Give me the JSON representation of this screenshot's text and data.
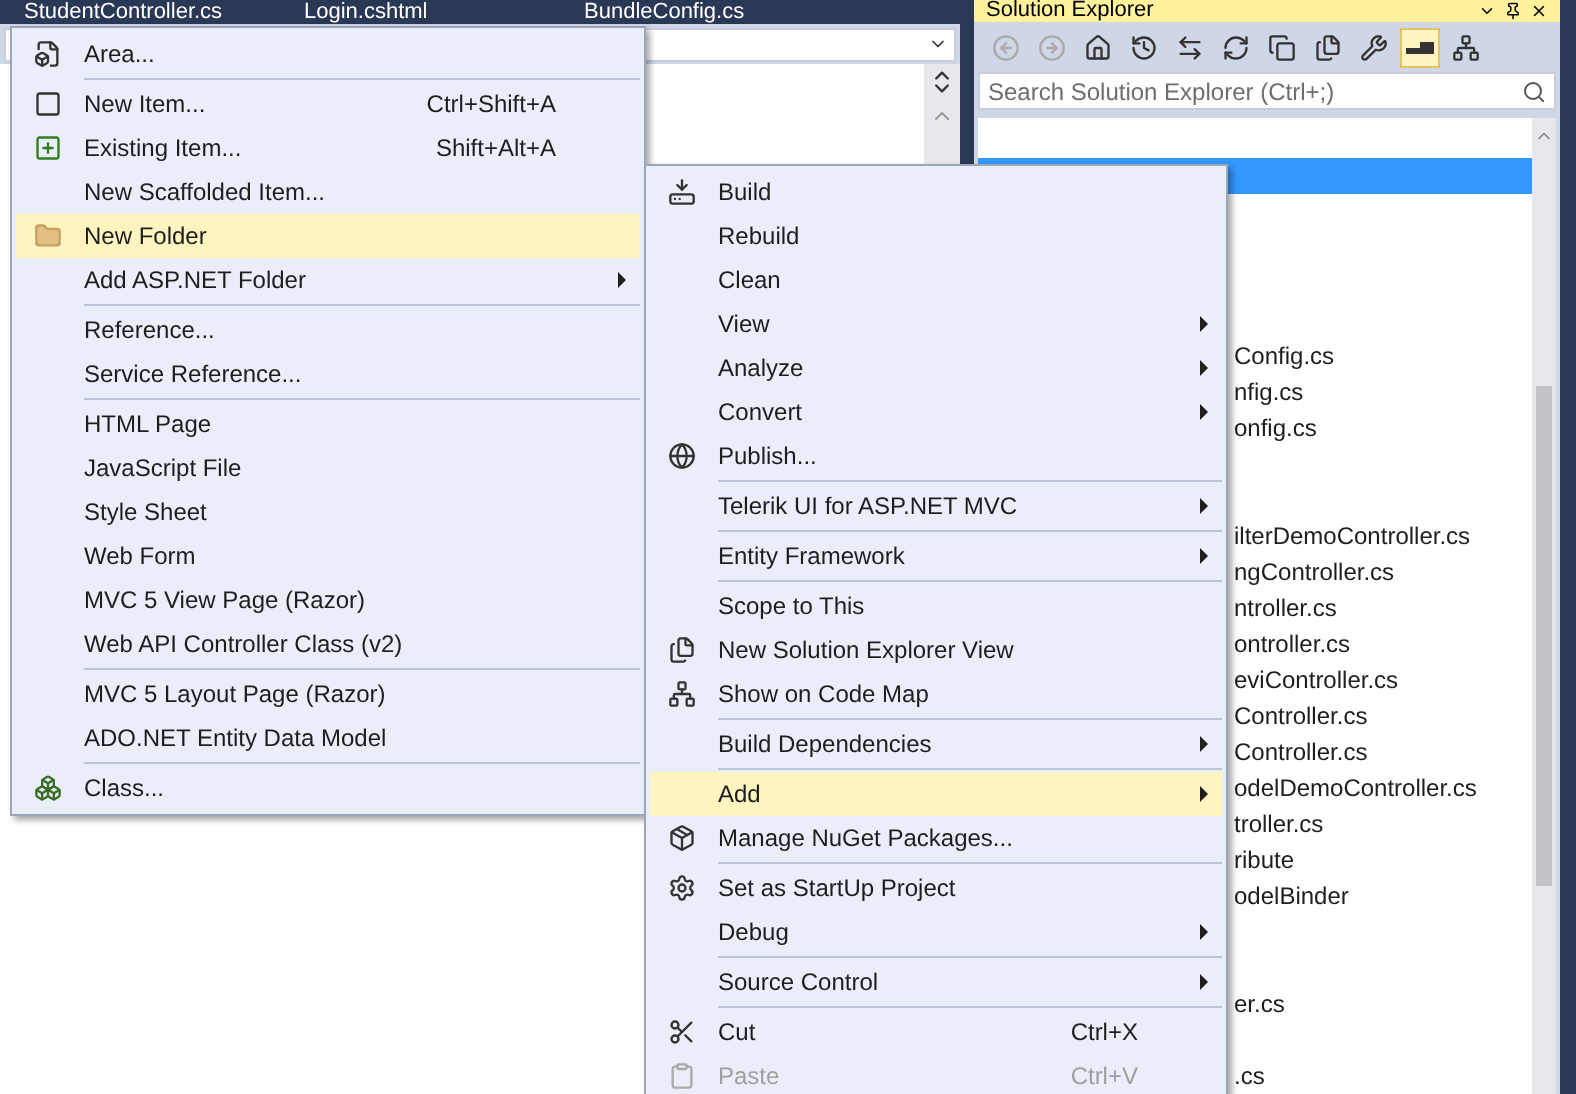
{
  "editor_tabs": [
    {
      "label": "StudentController.cs"
    },
    {
      "label": "Login.cshtml"
    },
    {
      "label": "BundleConfig.cs"
    }
  ],
  "solution_explorer": {
    "title": "Solution Explorer",
    "toolbar": [
      {
        "selected": false
      },
      {
        "selected": false
      },
      {
        "selected": false
      },
      {
        "selected": false
      },
      {
        "selected": false
      },
      {
        "selected": false
      },
      {
        "selected": false
      },
      {
        "selected": false
      },
      {
        "selected": false
      },
      {
        "selected": true
      },
      {
        "selected": false
      }
    ],
    "search": {
      "placeholder": "Search Solution Explorer (Ctrl+;)"
    },
    "rows": [
      {
        "selected": false
      },
      {
        "selected": true
      },
      {
        "selected": false
      },
      {
        "selected": false
      },
      {
        "selected": false
      },
      {
        "selected": false
      },
      {
        "label": "Config.cs",
        "selected": false
      },
      {
        "label": "nfig.cs",
        "selected": false
      },
      {
        "label": "onfig.cs",
        "selected": false
      },
      {
        "selected": false
      },
      {
        "selected": false
      },
      {
        "label": "ilterDemoController.cs",
        "selected": false
      },
      {
        "label": "ngController.cs",
        "selected": false
      },
      {
        "label": "ntroller.cs",
        "selected": false
      },
      {
        "label": "ontroller.cs",
        "selected": false
      },
      {
        "label": "eviController.cs",
        "selected": false
      },
      {
        "label": "Controller.cs",
        "selected": false
      },
      {
        "label": "Controller.cs",
        "selected": false
      },
      {
        "label": "odelDemoController.cs",
        "selected": false
      },
      {
        "label": "troller.cs",
        "selected": false
      },
      {
        "label": "ribute",
        "selected": false
      },
      {
        "label": "odelBinder",
        "selected": false
      },
      {
        "selected": false
      },
      {
        "selected": false
      },
      {
        "label": "er.cs",
        "selected": false
      },
      {
        "selected": false
      },
      {
        "label": ".cs",
        "selected": false
      }
    ]
  },
  "add_menu": [
    {
      "kind": "item",
      "label": "Area...",
      "selected": false
    },
    {
      "kind": "separator"
    },
    {
      "kind": "item",
      "label": "New Item...",
      "shortcut": "Ctrl+Shift+A",
      "selected": false
    },
    {
      "kind": "item",
      "label": "Existing Item...",
      "shortcut": "Shift+Alt+A",
      "selected": false
    },
    {
      "kind": "item",
      "label": "New Scaffolded Item...",
      "selected": false
    },
    {
      "kind": "item",
      "label": "New Folder",
      "selected": true
    },
    {
      "kind": "item",
      "label": "Add ASP.NET Folder",
      "submenu": true,
      "selected": false
    },
    {
      "kind": "separator"
    },
    {
      "kind": "item",
      "label": "Reference...",
      "selected": false
    },
    {
      "kind": "item",
      "label": "Service Reference...",
      "selected": false
    },
    {
      "kind": "separator"
    },
    {
      "kind": "item",
      "label": "HTML Page",
      "selected": false
    },
    {
      "kind": "item",
      "label": "JavaScript File",
      "selected": false
    },
    {
      "kind": "item",
      "label": "Style Sheet",
      "selected": false
    },
    {
      "kind": "item",
      "label": "Web Form",
      "selected": false
    },
    {
      "kind": "item",
      "label": "MVC 5 View Page (Razor)",
      "selected": false
    },
    {
      "kind": "item",
      "label": "Web API Controller Class (v2)",
      "selected": false
    },
    {
      "kind": "separator"
    },
    {
      "kind": "item",
      "label": "MVC 5 Layout Page (Razor)",
      "selected": false
    },
    {
      "kind": "item",
      "label": "ADO.NET Entity Data Model",
      "selected": false
    },
    {
      "kind": "separator"
    },
    {
      "kind": "item",
      "label": "Class...",
      "selected": false
    }
  ],
  "project_menu": [
    {
      "kind": "item",
      "label": "Build",
      "selected": false
    },
    {
      "kind": "item",
      "label": "Rebuild",
      "selected": false
    },
    {
      "kind": "item",
      "label": "Clean",
      "selected": false
    },
    {
      "kind": "item",
      "label": "View",
      "submenu": true,
      "selected": false
    },
    {
      "kind": "item",
      "label": "Analyze",
      "submenu": true,
      "selected": false
    },
    {
      "kind": "item",
      "label": "Convert",
      "submenu": true,
      "selected": false
    },
    {
      "kind": "item",
      "label": "Publish...",
      "selected": false
    },
    {
      "kind": "separator"
    },
    {
      "kind": "item",
      "label": "Telerik UI for ASP.NET MVC",
      "submenu": true,
      "selected": false
    },
    {
      "kind": "separator"
    },
    {
      "kind": "item",
      "label": "Entity Framework",
      "submenu": true,
      "selected": false
    },
    {
      "kind": "separator"
    },
    {
      "kind": "item",
      "label": "Scope to This",
      "selected": false
    },
    {
      "kind": "item",
      "label": "New Solution Explorer View",
      "selected": false
    },
    {
      "kind": "item",
      "label": "Show on Code Map",
      "selected": false
    },
    {
      "kind": "separator"
    },
    {
      "kind": "item",
      "label": "Build Dependencies",
      "submenu": true,
      "selected": false
    },
    {
      "kind": "separator"
    },
    {
      "kind": "item",
      "label": "Add",
      "submenu": true,
      "selected": true
    },
    {
      "kind": "item",
      "label": "Manage NuGet Packages...",
      "selected": false
    },
    {
      "kind": "separator"
    },
    {
      "kind": "item",
      "label": "Set as StartUp Project",
      "selected": false
    },
    {
      "kind": "item",
      "label": "Debug",
      "submenu": true,
      "selected": false
    },
    {
      "kind": "separator"
    },
    {
      "kind": "item",
      "label": "Source Control",
      "submenu": true,
      "selected": false
    },
    {
      "kind": "separator"
    },
    {
      "kind": "item",
      "label": "Cut",
      "shortcut": "Ctrl+X",
      "selected": false
    },
    {
      "kind": "item",
      "label": "Paste",
      "shortcut": "Ctrl+V",
      "disabled": true,
      "selected": false
    }
  ]
}
